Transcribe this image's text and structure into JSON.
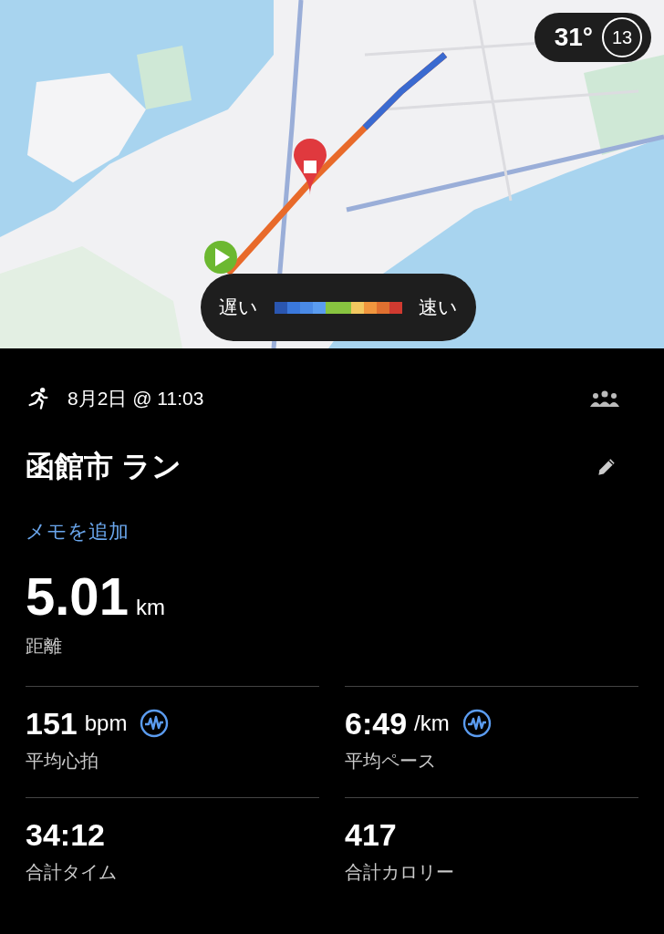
{
  "map": {
    "kind": "picture",
    "weather": {
      "temperature": "31°",
      "dial": "13"
    },
    "legend": {
      "slow_label": "遅い",
      "fast_label": "速い",
      "segments": [
        {
          "color": "#2a56b0"
        },
        {
          "color": "#3a78dc"
        },
        {
          "color": "#4a8ae6"
        },
        {
          "color": "#5a9cf0"
        },
        {
          "color": "#88c440"
        },
        {
          "color": "#88c440"
        },
        {
          "color": "#f2c860"
        },
        {
          "color": "#f0963e"
        },
        {
          "color": "#e07030"
        },
        {
          "color": "#d03a30"
        }
      ]
    }
  },
  "activity": {
    "date": "8月2日 @ 11:03",
    "title": "函館市 ラン",
    "add_note": "メモを追加"
  },
  "distance": {
    "value": "5.01",
    "unit": "km",
    "label": "距離"
  },
  "stats": [
    {
      "value": "151",
      "unit": "bpm",
      "label": "平均心拍",
      "has_graph": true
    },
    {
      "value": "6:49",
      "unit": "/km",
      "label": "平均ペース",
      "has_graph": true
    },
    {
      "value": "34:12",
      "label": "合計タイム",
      "has_graph": false
    },
    {
      "value": "417",
      "label": "合計カロリー",
      "has_graph": false
    }
  ]
}
